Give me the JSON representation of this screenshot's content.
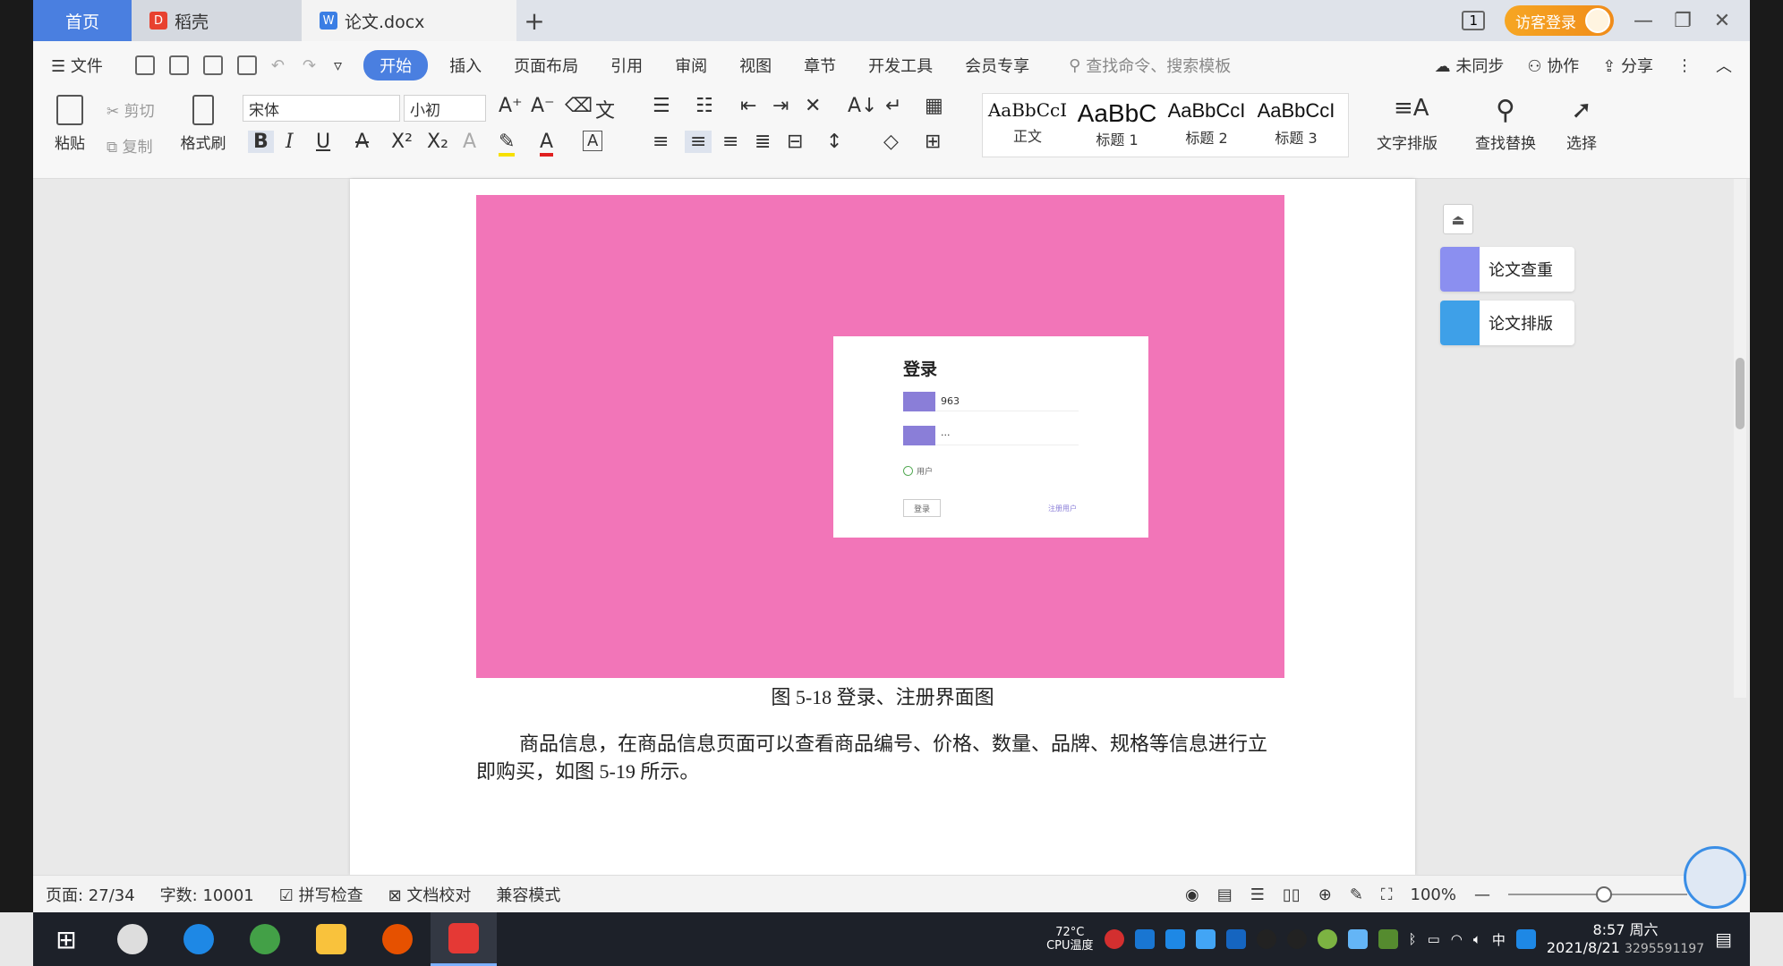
{
  "tabs": {
    "home": "首页",
    "docer": "稻壳",
    "doc": "论文.docx",
    "visitor_login": "访客登录",
    "badge": "1"
  },
  "menu": {
    "file": "文件",
    "items": [
      "开始",
      "插入",
      "页面布局",
      "引用",
      "审阅",
      "视图",
      "章节",
      "开发工具",
      "会员专享"
    ],
    "search_placeholder": "查找命令、搜索模板",
    "sync": "未同步",
    "collab": "协作",
    "share": "分享"
  },
  "ribbon": {
    "paste": "粘贴",
    "cut": "剪切",
    "copy": "复制",
    "format_painter": "格式刷",
    "font": "宋体",
    "size": "小初",
    "styles": [
      {
        "preview": "AaBbCcI",
        "name": "正文"
      },
      {
        "preview": "AaBbC",
        "name": "标题 1"
      },
      {
        "preview": "AaBbCcI",
        "name": "标题 2"
      },
      {
        "preview": "AaBbCcI",
        "name": "标题 3"
      }
    ],
    "text_layout": "文字排版",
    "find_replace": "查找替换",
    "select": "选择"
  },
  "document": {
    "login_title": "登录",
    "login_user": "963",
    "login_pass": "···",
    "login_role": "用户",
    "login_button": "登录",
    "login_register": "注册用户",
    "caption": "图 5-18 登录、注册界面图",
    "paragraph": "商品信息，在商品信息页面可以查看商品编号、价格、数量、品牌、规格等信息进行立即购买，如图 5-19 所示。"
  },
  "side_panel": {
    "check": "论文查重",
    "layout": "论文排版"
  },
  "status": {
    "page": "页面: 27/34",
    "words": "字数: 10001",
    "spell": "拼写检查",
    "proof": "文档校对",
    "compat": "兼容模式",
    "zoom": "100%"
  },
  "taskbar": {
    "cpu_temp": "72°C",
    "cpu_label": "CPU温度",
    "ime": "中",
    "time": "8:57 周六",
    "date": "2021/8/21",
    "overlay_num": "3295591197"
  },
  "colors": {
    "accent": "#4a7fe0",
    "image_pink": "#f275b8",
    "login_icon": "#8a7ed8"
  }
}
